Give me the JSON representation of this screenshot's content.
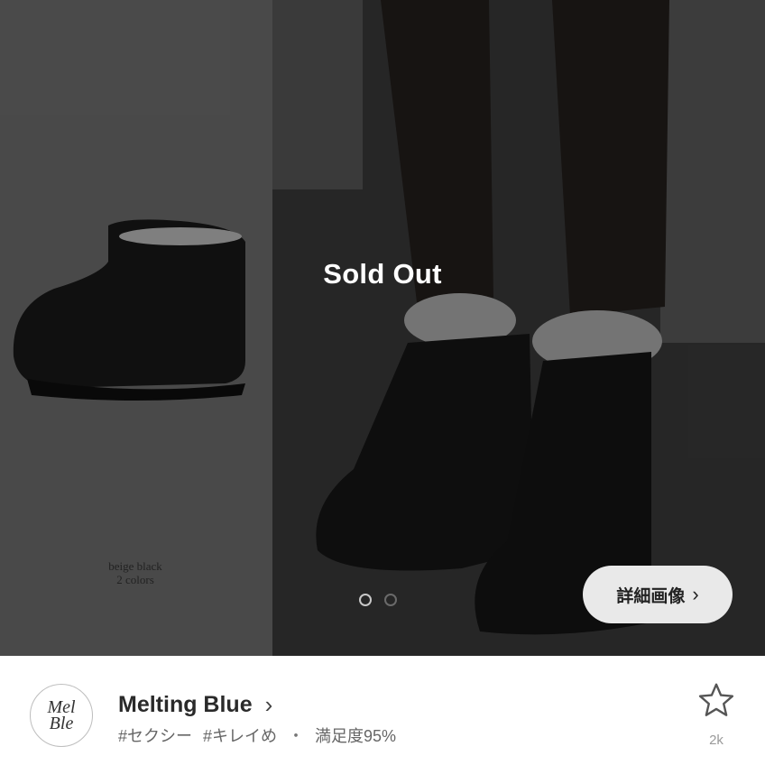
{
  "hero": {
    "sold_out_label": "Sold Out",
    "color_note_line1": "beige black",
    "color_note_line2": "2 colors",
    "detail_button_label": "詳細画像",
    "carousel": {
      "total": 2,
      "active_index": 0
    }
  },
  "shop": {
    "logo_line1": "Mel",
    "logo_line2": "Ble",
    "name": "Melting Blue",
    "tag1": "#セクシー",
    "tag2": "#キレイめ",
    "separator": "・",
    "satisfaction": "満足度95%",
    "favorite_count": "2k"
  },
  "icons": {
    "shop_chevron": "chevron-right-icon",
    "favorite": "star-outline-icon",
    "detail_chevron": "chevron-right-icon"
  },
  "colors": {
    "overlay": "#3a3a3a",
    "button_bg": "#e9e9e9",
    "text_primary": "#2a2a2a",
    "text_secondary": "#666666"
  }
}
